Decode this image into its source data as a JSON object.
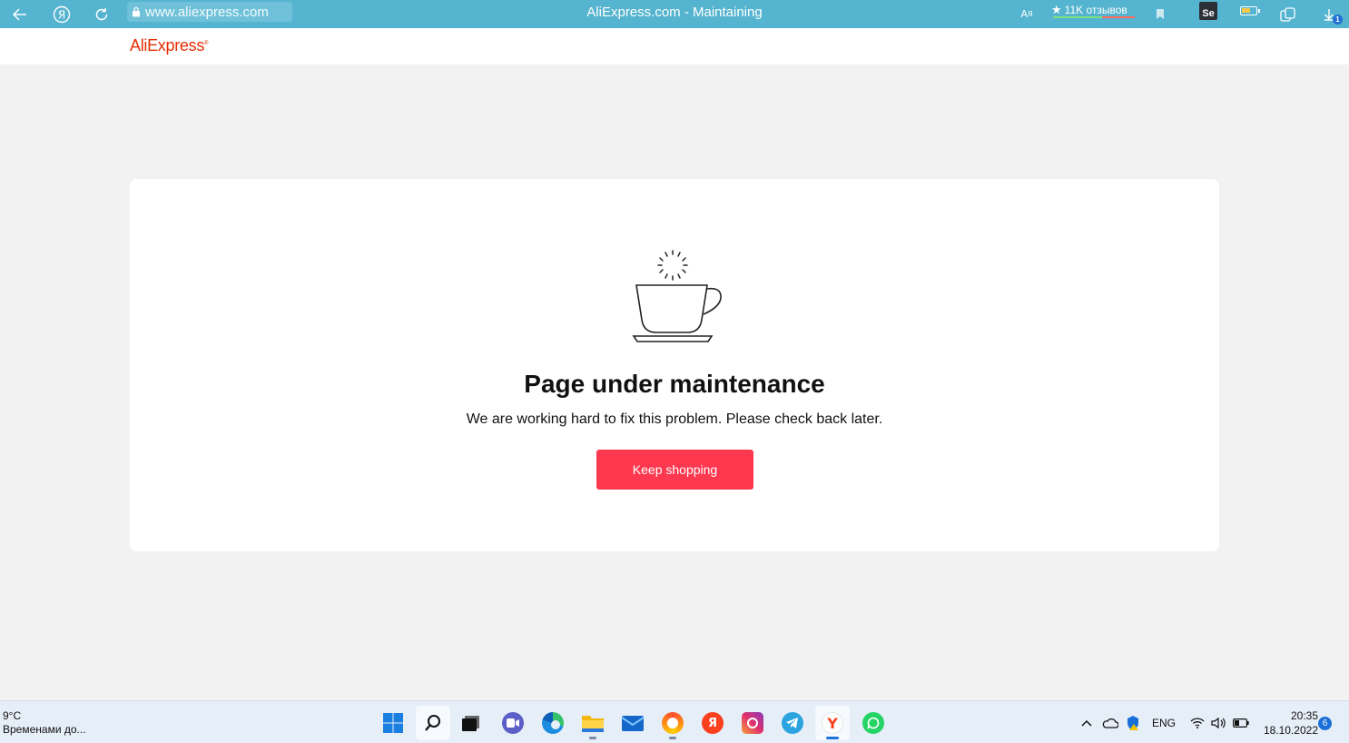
{
  "browser": {
    "url": "www.aliexpress.com",
    "tab_title": "AliExpress.com - Maintaining",
    "reviews_label": "11K отзывов",
    "se_label": "Se",
    "downloads_count": "1",
    "icons": [
      "back-arrow-icon",
      "yandex-icon",
      "reload-icon",
      "lock-icon",
      "translate-icon",
      "star-icon",
      "bookmark-icon",
      "seo-extension-icon",
      "battery-icon",
      "collections-icon",
      "download-icon"
    ]
  },
  "site": {
    "logo": "AliExpress",
    "logo_mark": "®",
    "brand_color": "#e62e04"
  },
  "maintenance": {
    "title": "Page under maintenance",
    "message": "We are working hard to fix this problem. Please check back later.",
    "button_label": "Keep shopping",
    "button_color": "#fd384f",
    "illustration": "coffee-cup-icon"
  },
  "taskbar": {
    "weather_temp": "9°C",
    "weather_desc": "Временами до...",
    "apps": [
      "windows-start",
      "search",
      "task-view",
      "chat",
      "edge",
      "file-explorer",
      "mail",
      "yandex-music",
      "yandex",
      "instagram",
      "telegram",
      "yandex-browser",
      "whatsapp"
    ],
    "language": "ENG",
    "time": "20:35",
    "date": "18.10.2022",
    "notifications": "6"
  }
}
